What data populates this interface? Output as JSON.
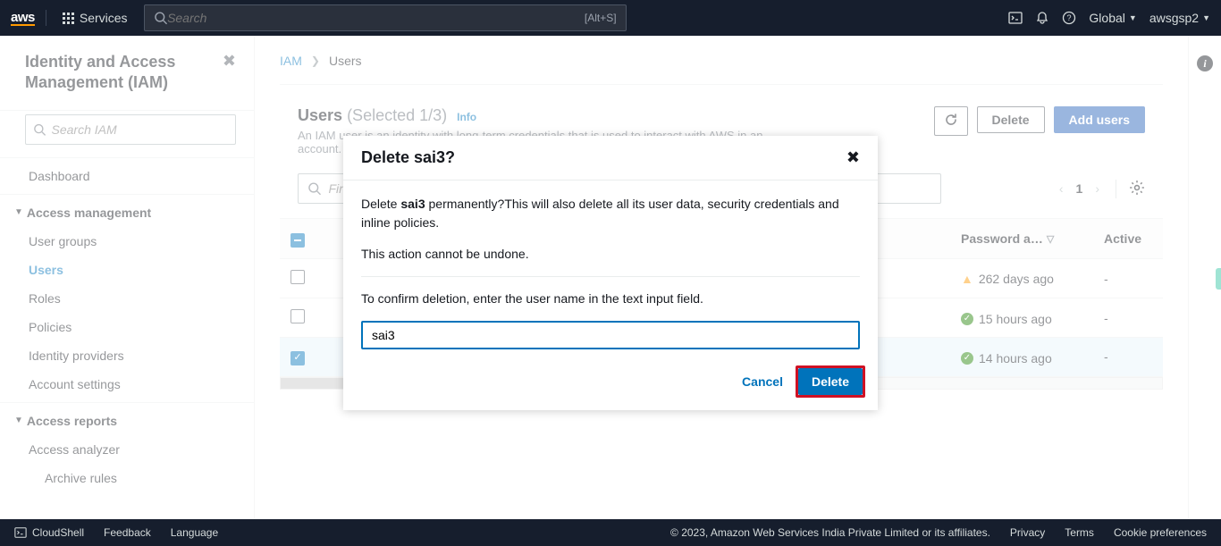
{
  "topnav": {
    "logo_text": "aws",
    "services_label": "Services",
    "search_placeholder": "Search",
    "search_shortcut": "[Alt+S]",
    "region": "Global",
    "account": "awsgsp2"
  },
  "sidebar": {
    "title": "Identity and Access Management (IAM)",
    "search_placeholder": "Search IAM",
    "sections": [
      {
        "label": "Dashboard",
        "kind": "item"
      },
      {
        "label": "Access management",
        "kind": "section"
      },
      {
        "label": "User groups",
        "kind": "item"
      },
      {
        "label": "Users",
        "kind": "item",
        "active": true
      },
      {
        "label": "Roles",
        "kind": "item"
      },
      {
        "label": "Policies",
        "kind": "item"
      },
      {
        "label": "Identity providers",
        "kind": "item"
      },
      {
        "label": "Account settings",
        "kind": "item"
      },
      {
        "label": "Access reports",
        "kind": "section"
      },
      {
        "label": "Access analyzer",
        "kind": "item"
      },
      {
        "label": "Archive rules",
        "kind": "sub"
      }
    ]
  },
  "breadcrumb": {
    "root": "IAM",
    "current": "Users"
  },
  "users_panel": {
    "title_main": "Users",
    "title_suffix": "(Selected 1/3)",
    "info_label": "Info",
    "description": "An IAM user is an identity with long-term credentials that is used to interact with AWS in an account.",
    "refresh_label": "↻",
    "delete_label": "Delete",
    "add_label": "Add users",
    "filter_placeholder": "Find users by username or access key",
    "page_number": "1",
    "columns": {
      "password": "Password a…",
      "activity": "Active"
    },
    "rows": [
      {
        "selected": false,
        "password_age": "262 days ago",
        "password_status": "warn",
        "activity": "-"
      },
      {
        "selected": false,
        "password_age": "15 hours ago",
        "password_status": "ok",
        "activity": "-"
      },
      {
        "selected": true,
        "password_age": "14 hours ago",
        "password_status": "ok",
        "activity": "-"
      }
    ]
  },
  "modal": {
    "title": "Delete sai3?",
    "p1_pre": "Delete ",
    "p1_bold": "sai3",
    "p1_post": " permanently?This will also delete all its user data, security credentials and inline policies.",
    "p2": "This action cannot be undone.",
    "p3": "To confirm deletion, enter the user name in the text input field.",
    "input_value": "sai3",
    "cancel": "Cancel",
    "delete": "Delete"
  },
  "footer": {
    "cloudshell": "CloudShell",
    "feedback": "Feedback",
    "language": "Language",
    "copyright": "© 2023, Amazon Web Services India Private Limited or its affiliates.",
    "privacy": "Privacy",
    "terms": "Terms",
    "cookies": "Cookie preferences"
  }
}
